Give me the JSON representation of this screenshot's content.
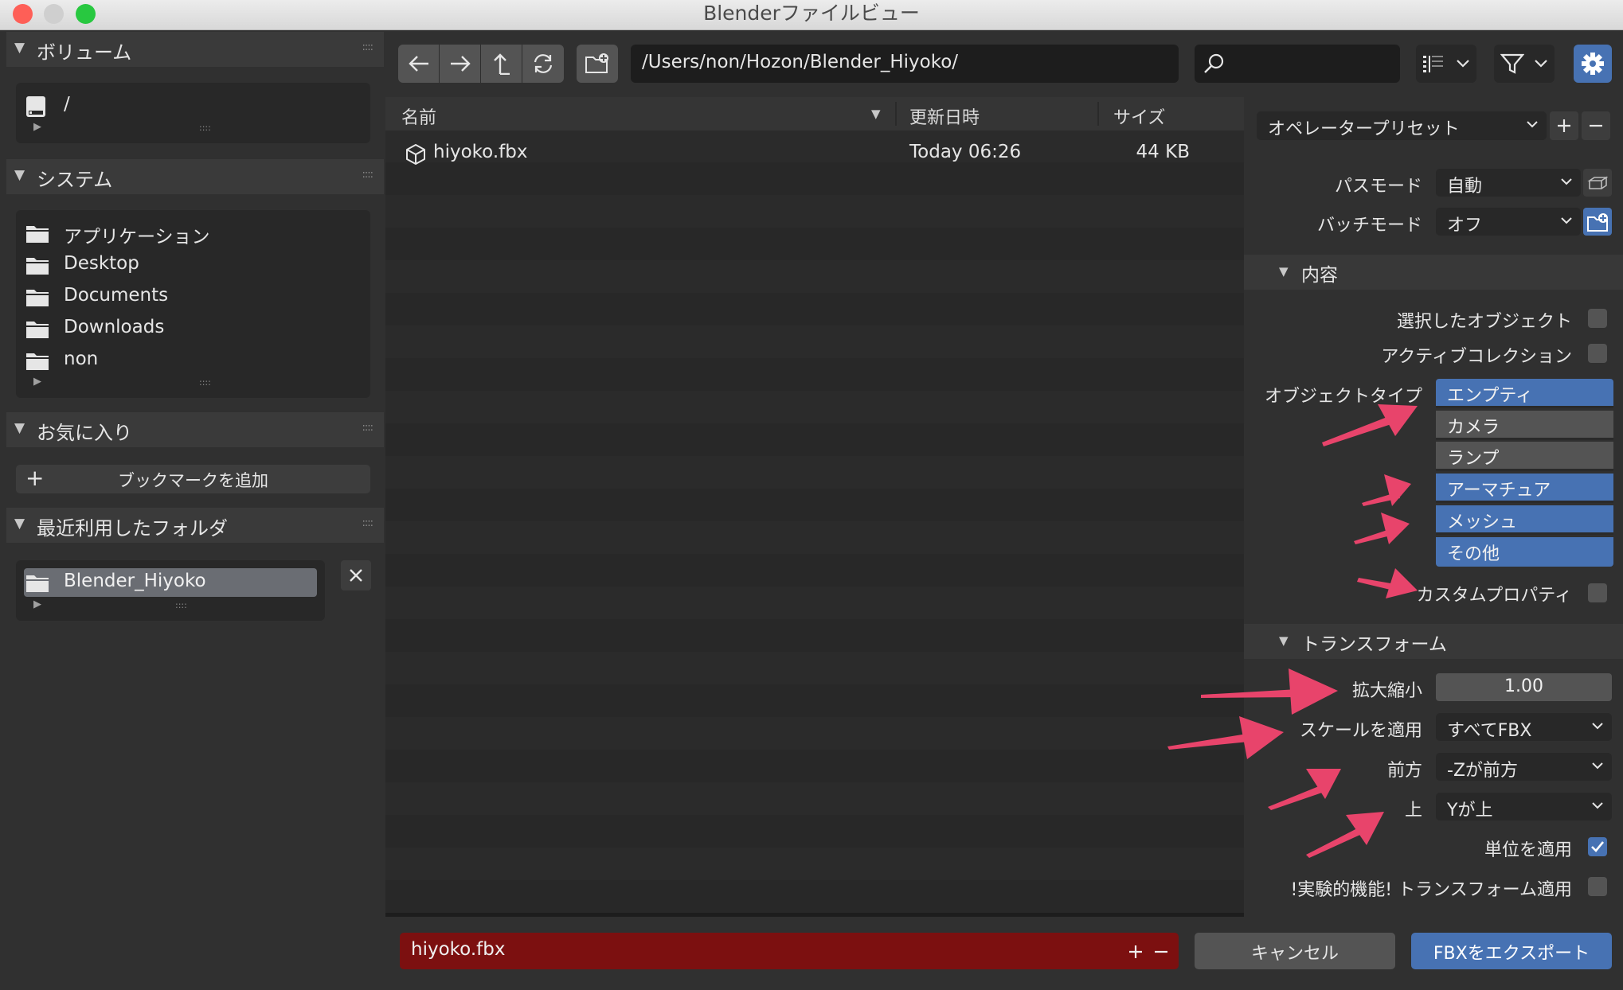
{
  "window": {
    "title": "Blenderファイルビュー"
  },
  "sidebar": {
    "volumes": {
      "title": "ボリューム",
      "items": [
        {
          "label": "/",
          "icon": "disk-icon"
        }
      ]
    },
    "system": {
      "title": "システム",
      "items": [
        {
          "label": "アプリケーション",
          "icon": "folder-icon"
        },
        {
          "label": "Desktop",
          "icon": "folder-icon"
        },
        {
          "label": "Documents",
          "icon": "folder-icon"
        },
        {
          "label": "Downloads",
          "icon": "folder-icon"
        },
        {
          "label": "non",
          "icon": "folder-icon"
        }
      ]
    },
    "favorites": {
      "title": "お気に入り",
      "add_bookmark": "ブックマークを追加"
    },
    "recent": {
      "title": "最近利用したフォルダ",
      "items": [
        {
          "label": "Blender_Hiyoko",
          "icon": "folder-icon",
          "selected": true
        }
      ]
    }
  },
  "toolbar": {
    "path": "/Users/non/Hozon/Blender_Hiyoko/",
    "search_value": ""
  },
  "filelist": {
    "columns": {
      "name": "名前",
      "modified": "更新日時",
      "size": "サイズ"
    },
    "rows": [
      {
        "name": "hiyoko.fbx",
        "modified": "Today 06:26",
        "size": "44 KB",
        "icon": "cube-icon"
      }
    ]
  },
  "panel": {
    "operator_preset": "オペレータープリセット",
    "path_mode": {
      "label": "パスモード",
      "value": "自動"
    },
    "batch_mode": {
      "label": "バッチモード",
      "value": "オフ"
    },
    "contents": {
      "title": "内容",
      "selected_objects": {
        "label": "選択したオブジェクト",
        "checked": false
      },
      "active_collection": {
        "label": "アクティブコレクション",
        "checked": false
      },
      "object_type_label": "オブジェクトタイプ",
      "object_types": [
        {
          "label": "エンプティ",
          "on": true
        },
        {
          "label": "カメラ",
          "on": false
        },
        {
          "label": "ランプ",
          "on": false
        },
        {
          "label": "アーマチュア",
          "on": true
        },
        {
          "label": "メッシュ",
          "on": true
        },
        {
          "label": "その他",
          "on": true
        }
      ],
      "custom_properties": {
        "label": "カスタムプロパティ",
        "checked": false
      }
    },
    "transform": {
      "title": "トランスフォーム",
      "scale": {
        "label": "拡大縮小",
        "value": "1.00"
      },
      "apply_scale": {
        "label": "スケールを適用",
        "value": "すべてFBX"
      },
      "forward": {
        "label": "前方",
        "value": "-Zが前方"
      },
      "up": {
        "label": "上",
        "value": "Yが上"
      },
      "apply_unit": {
        "label": "単位を適用",
        "checked": true
      },
      "experimental": {
        "label": "!実験的機能! トランスフォーム適用",
        "checked": false
      }
    }
  },
  "bottom": {
    "filename": "hiyoko.fbx",
    "cancel": "キャンセル",
    "export": "FBXをエクスポート"
  },
  "colors": {
    "accent": "#4772b3",
    "filename_bg": "#7c1010",
    "arrow": "#e8446b",
    "close": "#fe5f57",
    "minimize": "#febc2e",
    "maximize": "#28c840"
  }
}
